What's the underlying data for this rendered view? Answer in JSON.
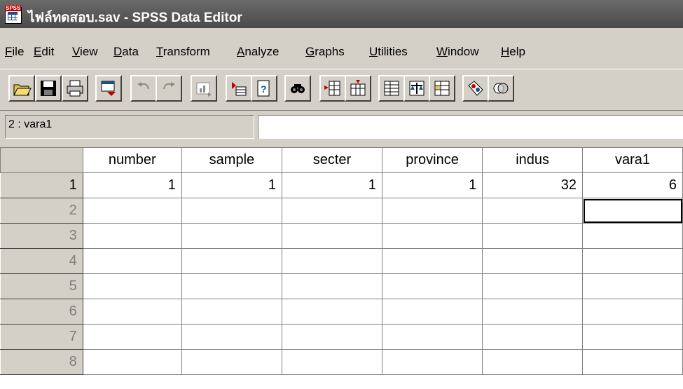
{
  "window": {
    "title": "ไฟล์ทดสอบ.sav - SPSS Data Editor",
    "app_badge": "SPSS"
  },
  "menu": [
    "File",
    "Edit",
    "View",
    "Data",
    "Transform",
    "Analyze",
    "Graphs",
    "Utilities",
    "Window",
    "Help"
  ],
  "toolbar": [
    {
      "name": "open-file-icon"
    },
    {
      "name": "save-icon"
    },
    {
      "name": "print-icon"
    },
    {
      "name": "dialog-recall-icon"
    },
    {
      "name": "undo-icon"
    },
    {
      "name": "redo-icon"
    },
    {
      "name": "goto-chart-icon"
    },
    {
      "name": "goto-case-icon"
    },
    {
      "name": "variables-icon"
    },
    {
      "name": "find-icon"
    },
    {
      "name": "insert-cases-icon"
    },
    {
      "name": "insert-variable-icon"
    },
    {
      "name": "split-file-icon"
    },
    {
      "name": "weight-cases-icon"
    },
    {
      "name": "select-cases-icon"
    },
    {
      "name": "value-labels-icon"
    },
    {
      "name": "use-sets-icon"
    }
  ],
  "cell_editor": {
    "cell_name": "2 : vara1",
    "cell_value": ""
  },
  "grid": {
    "columns": [
      "number",
      "sample",
      "secter",
      "province",
      "indus",
      "vara1"
    ],
    "row_numbers": [
      "1",
      "2",
      "3",
      "4",
      "5",
      "6",
      "7",
      "8"
    ],
    "rows": [
      [
        "1",
        "1",
        "1",
        "1",
        "32",
        "6"
      ],
      [
        "",
        "",
        "",
        "",
        "",
        ""
      ],
      [
        "",
        "",
        "",
        "",
        "",
        ""
      ],
      [
        "",
        "",
        "",
        "",
        "",
        ""
      ],
      [
        "",
        "",
        "",
        "",
        "",
        ""
      ],
      [
        "",
        "",
        "",
        "",
        "",
        ""
      ],
      [
        "",
        "",
        "",
        "",
        "",
        ""
      ],
      [
        "",
        "",
        "",
        "",
        "",
        ""
      ]
    ]
  }
}
